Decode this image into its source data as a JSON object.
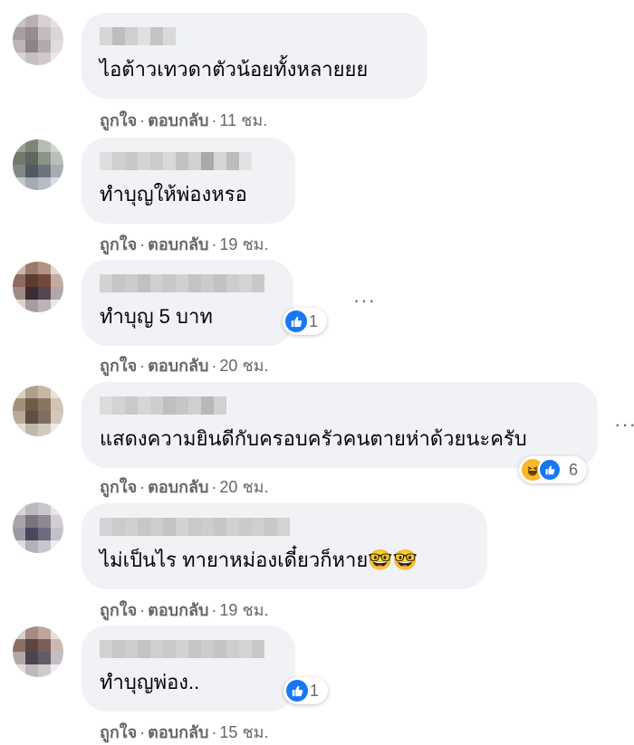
{
  "comments": [
    {
      "text": "ไอต้าวเทวดาตัวน้อยทั้งหลายยย",
      "like_label": "ถูกใจ",
      "reply_label": "ตอบกลับ",
      "separator": "·",
      "time": "11 ชม."
    },
    {
      "text": "ทำบุญให้พ่องหรอ",
      "like_label": "ถูกใจ",
      "reply_label": "ตอบกลับ",
      "separator": "·",
      "time": "19 ชม."
    },
    {
      "text": "ทำบุญ 5 บาท",
      "like_label": "ถูกใจ",
      "reply_label": "ตอบกลับ",
      "separator": "·",
      "time": "20 ชม.",
      "reaction_count": "1",
      "reaction_icons": [
        "like-icon"
      ],
      "more": "···"
    },
    {
      "text": "แสดงความยินดีกับครอบครัวคนตายห่าด้วยนะครับ",
      "like_label": "ถูกใจ",
      "reply_label": "ตอบกลับ",
      "separator": "·",
      "time": "20 ชม.",
      "reaction_count": "6",
      "reaction_icons": [
        "haha-icon",
        "like-icon"
      ],
      "more": "···"
    },
    {
      "text": "ไม่เป็นไร ทายาหม่องเดี๋ยวก็หาย🤓🤓",
      "like_label": "ถูกใจ",
      "reply_label": "ตอบกลับ",
      "separator": "·",
      "time": "19 ชม."
    },
    {
      "text": "ทำบุญพ่อง..",
      "like_label": "ถูกใจ",
      "reply_label": "ตอบกลับ",
      "separator": "·",
      "time": "15 ชม.",
      "reaction_count": "1",
      "reaction_icons": [
        "like-icon"
      ]
    }
  ],
  "colors": {
    "bubble": "#f0f2f5",
    "secondary_text": "#65676b",
    "like_blue": "#1877f2",
    "haha_yellow": "#f7b928"
  }
}
